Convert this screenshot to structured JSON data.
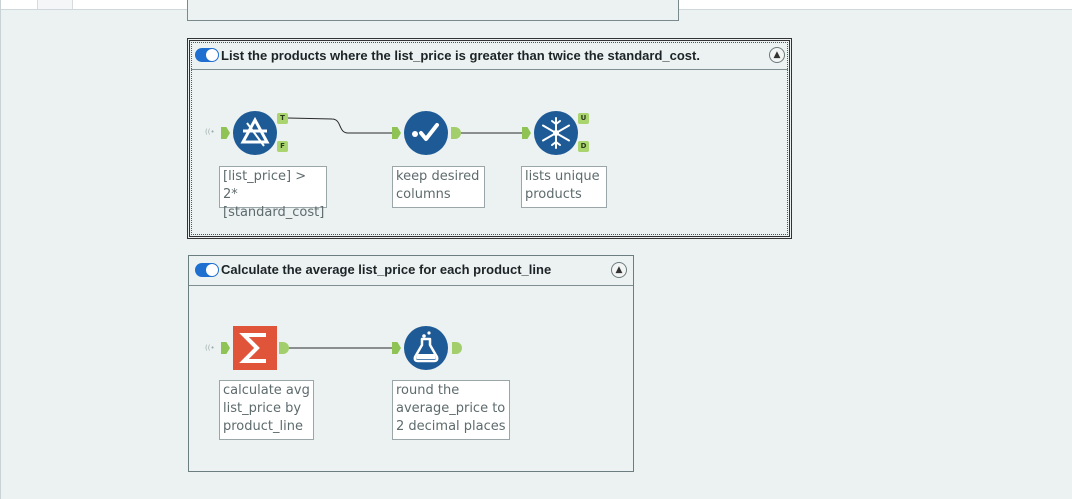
{
  "containers": [
    {
      "title": "List the products where the list_price is greater than twice the standard_cost.",
      "collapse_glyph": "▲",
      "tools": [
        {
          "icon": "filter-icon",
          "annotation": "[list_price] > 2*\n[standard_cost]",
          "anchors": [
            "T",
            "F"
          ]
        },
        {
          "icon": "select-icon",
          "annotation": "keep desired\ncolumns"
        },
        {
          "icon": "unique-icon",
          "annotation": "lists unique\nproducts",
          "anchors": [
            "U",
            "D"
          ]
        }
      ]
    },
    {
      "title": "Calculate the average list_price for each product_line",
      "collapse_glyph": "▲",
      "tools": [
        {
          "icon": "summarize-icon",
          "glyph": "Σ",
          "annotation": "calculate avg\nlist_price by\nproduct_line"
        },
        {
          "icon": "formula-icon",
          "annotation": "round the\naverage_price to\n2 decimal places"
        }
      ]
    }
  ],
  "colors": {
    "tool_blue": "#1d5a96",
    "summarize_orange": "#e0553a",
    "anchor_green": "#8fc355",
    "toggle_blue": "#1f6fd1"
  }
}
